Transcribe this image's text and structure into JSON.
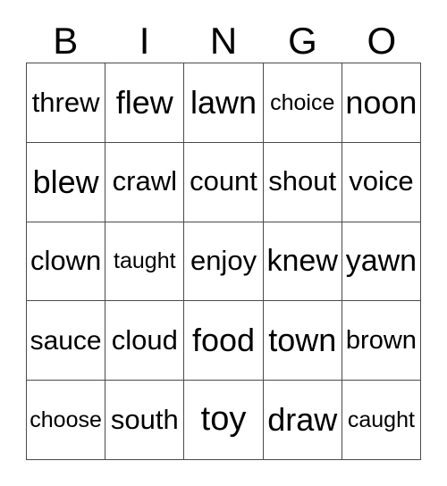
{
  "card": {
    "title": "BINGO",
    "headers": [
      "B",
      "I",
      "N",
      "G",
      "O"
    ],
    "rows": [
      [
        "threw",
        "flew",
        "lawn",
        "choice",
        "noon"
      ],
      [
        "blew",
        "crawl",
        "count",
        "shout",
        "voice"
      ],
      [
        "clown",
        "taught",
        "enjoy",
        "knew",
        "yawn"
      ],
      [
        "sauce",
        "cloud",
        "food",
        "town",
        "brown"
      ],
      [
        "choose",
        "south",
        "toy",
        "draw",
        "caught"
      ]
    ],
    "colors": {
      "background": "#ffffff",
      "text": "#000000",
      "grid_line": "#4a4a4a"
    }
  }
}
